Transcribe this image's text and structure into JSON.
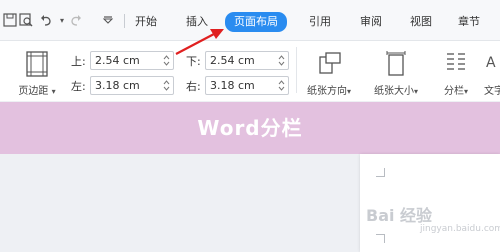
{
  "tabs": [
    {
      "label": "开始"
    },
    {
      "label": "插入"
    },
    {
      "label": "页面布局"
    },
    {
      "label": "引用"
    },
    {
      "label": "审阅"
    },
    {
      "label": "视图"
    },
    {
      "label": "章节"
    }
  ],
  "ribbon": {
    "margins_label": "页边距",
    "top_label": "上:",
    "top_value": "2.54 cm",
    "bottom_label": "下:",
    "bottom_value": "2.54 cm",
    "left_label": "左:",
    "left_value": "3.18 cm",
    "right_label": "右:",
    "right_value": "3.18 cm",
    "orientation_label": "纸张方向",
    "size_label": "纸张大小",
    "columns_label": "分栏",
    "text_label": "文字"
  },
  "banner": {
    "title": "Word分栏"
  },
  "watermark": {
    "text": "Bai 经验",
    "sub": "jingyan.baidu.com"
  },
  "colors": {
    "accent": "#2a8cf0",
    "banner": "#e3c1df",
    "arrow": "#e02020"
  },
  "icons": [
    "save-icon",
    "print-preview-icon",
    "undo-icon",
    "redo-icon",
    "customize-icon",
    "margins-icon",
    "orientation-icon",
    "paper-size-icon",
    "columns-icon",
    "text-direction-icon"
  ]
}
